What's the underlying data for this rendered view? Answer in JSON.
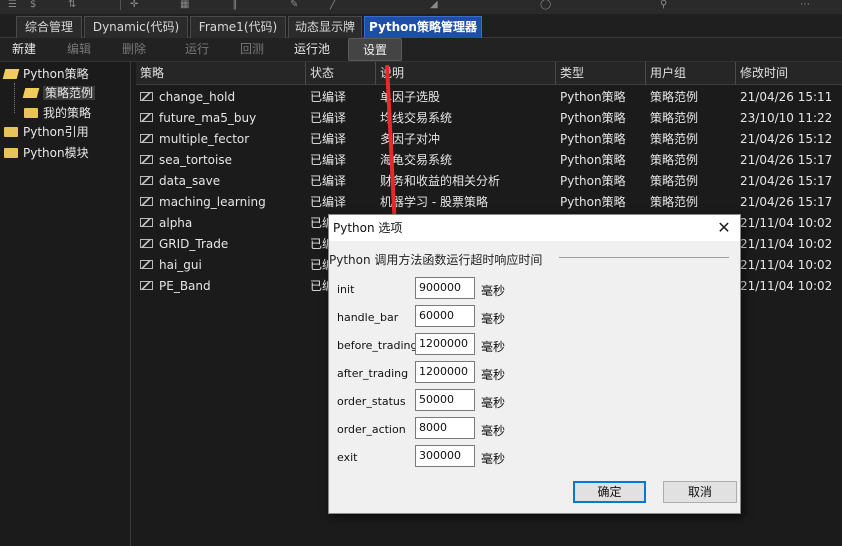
{
  "tabs": [
    {
      "label": "综合管理"
    },
    {
      "label": "Dynamic(代码)"
    },
    {
      "label": "Frame1(代码)"
    },
    {
      "label": "动态显示牌"
    },
    {
      "label": "Python策略管理器"
    }
  ],
  "toolbar": {
    "new": "新建",
    "edit": "编辑",
    "delete": "删除",
    "run": "运行",
    "backtest": "回测",
    "run_pool": "运行池",
    "settings": "设置"
  },
  "tree": {
    "python_strategy": "Python策略",
    "strategy_examples": "策略范例",
    "my_strategies": "我的策略",
    "python_refs": "Python引用",
    "python_modules": "Python模块"
  },
  "table": {
    "headers": [
      "策略",
      "状态",
      "说明",
      "类型",
      "用户组",
      "修改时间"
    ],
    "rows": [
      {
        "name": "change_hold",
        "status": "已编译",
        "desc": "单因子选股",
        "type": "Python策略",
        "group": "策略范例",
        "time": "21/04/26 15:11"
      },
      {
        "name": "future_ma5_buy",
        "status": "已编译",
        "desc": "均线交易系统",
        "type": "Python策略",
        "group": "策略范例",
        "time": "23/10/10 11:22"
      },
      {
        "name": "multiple_fector",
        "status": "已编译",
        "desc": "多因子对冲",
        "type": "Python策略",
        "group": "策略范例",
        "time": "21/04/26 15:12"
      },
      {
        "name": "sea_tortoise",
        "status": "已编译",
        "desc": "海龟交易系统",
        "type": "Python策略",
        "group": "策略范例",
        "time": "21/04/26 15:17"
      },
      {
        "name": "data_save",
        "status": "已编译",
        "desc": "财务和收益的相关分析",
        "type": "Python策略",
        "group": "策略范例",
        "time": "21/04/26 15:17"
      },
      {
        "name": "maching_learning",
        "status": "已编译",
        "desc": "机器学习 - 股票策略",
        "type": "Python策略",
        "group": "策略范例",
        "time": "21/04/26 15:17"
      },
      {
        "name": "alpha",
        "status": "已编",
        "desc": "",
        "type": "",
        "group": "",
        "time": "21/11/04 10:02"
      },
      {
        "name": "GRID_Trade",
        "status": "已编",
        "desc": "",
        "type": "",
        "group": "",
        "time": "21/11/04 10:02"
      },
      {
        "name": "hai_gui",
        "status": "已编",
        "desc": "",
        "type": "",
        "group": "",
        "time": "21/11/04 10:02"
      },
      {
        "name": "PE_Band",
        "status": "已编",
        "desc": "",
        "type": "",
        "group": "",
        "time": "21/11/04 10:02"
      }
    ]
  },
  "dialog": {
    "title": "Python 选项",
    "close": "✕",
    "group_label": "Python 调用方法函数运行超时响应时间",
    "fields": [
      {
        "label": "init",
        "value": "900000",
        "unit": "毫秒"
      },
      {
        "label": "handle_bar",
        "value": "60000",
        "unit": "毫秒"
      },
      {
        "label": "before_trading",
        "value": "1200000",
        "unit": "毫秒"
      },
      {
        "label": "after_trading",
        "value": "1200000",
        "unit": "毫秒"
      },
      {
        "label": "order_status",
        "value": "50000",
        "unit": "毫秒"
      },
      {
        "label": "order_action",
        "value": "8000",
        "unit": "毫秒"
      },
      {
        "label": "exit",
        "value": "300000",
        "unit": "毫秒"
      }
    ],
    "ok": "确定",
    "cancel": "取消"
  },
  "colors": {
    "active_tab": "#1e4ea8",
    "annotation_arrow": "#e8282a",
    "dialog_bg": "#f0f0f0",
    "primary_button_border": "#0078d7"
  }
}
